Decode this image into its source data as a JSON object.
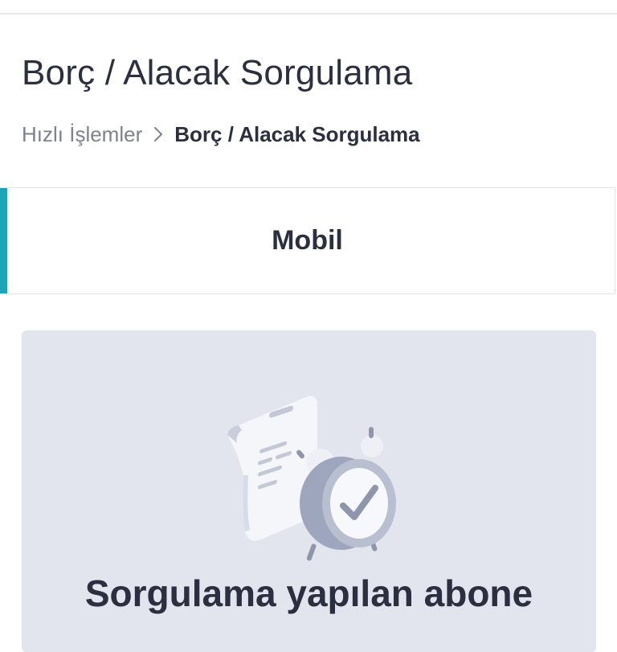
{
  "page": {
    "title": "Borç / Alacak Sorgulama"
  },
  "breadcrumb": {
    "parent_label": "Hızlı İşlemler",
    "current_label": "Borç / Alacak Sorgulama"
  },
  "tabs": [
    {
      "label": "Mobil",
      "active": true
    }
  ],
  "empty_state": {
    "icon": "receipt-alarm-clock-check-illustration",
    "message": "Sorgulama yapılan abone"
  },
  "colors": {
    "accent": "#1aa6b7",
    "text_primary": "#2b2f3f",
    "text_muted": "#7d8190",
    "card_background": "#e2e5ee"
  }
}
